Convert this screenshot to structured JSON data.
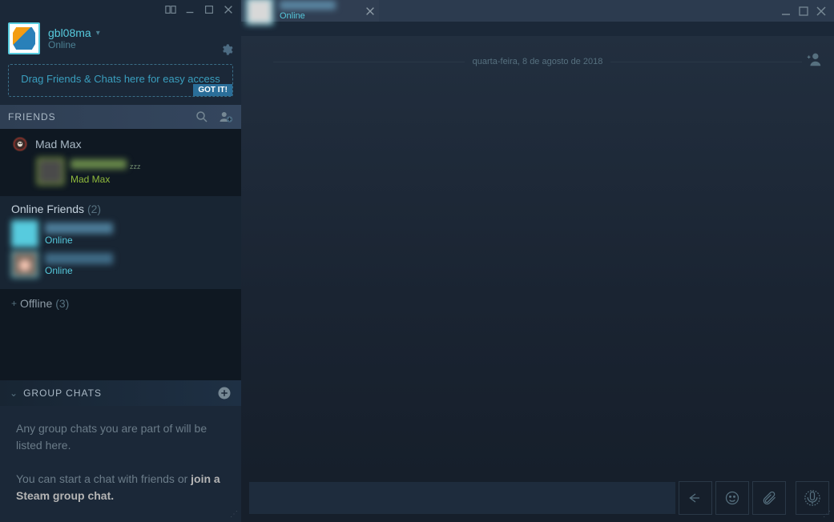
{
  "friends_window": {
    "self": {
      "name": "gbl08ma",
      "status": "Online"
    },
    "hint": {
      "text": "Drag Friends & Chats here for easy access",
      "gotit": "GOT IT!"
    },
    "friends_label": "FRIENDS",
    "game": {
      "name": "Mad Max",
      "friend_name": "",
      "friend_game": "Mad Max",
      "zzz": "zzz"
    },
    "online_section": {
      "title": "Online Friends",
      "count": "(2)",
      "friends": [
        {
          "status": "Online"
        },
        {
          "status": "Online"
        }
      ]
    },
    "offline_section": {
      "label": "Offline",
      "count": "(3)"
    },
    "groupchats": {
      "label": "GROUP CHATS",
      "body_line1": "Any group chats you are part of will be listed here.",
      "body_line2_a": "You can start a chat with friends or ",
      "body_line2_b": "join a Steam group chat."
    }
  },
  "chat_window": {
    "tab": {
      "status": "Online"
    },
    "date_separator": "quarta-feira, 8 de agosto de 2018",
    "input_placeholder": ""
  }
}
